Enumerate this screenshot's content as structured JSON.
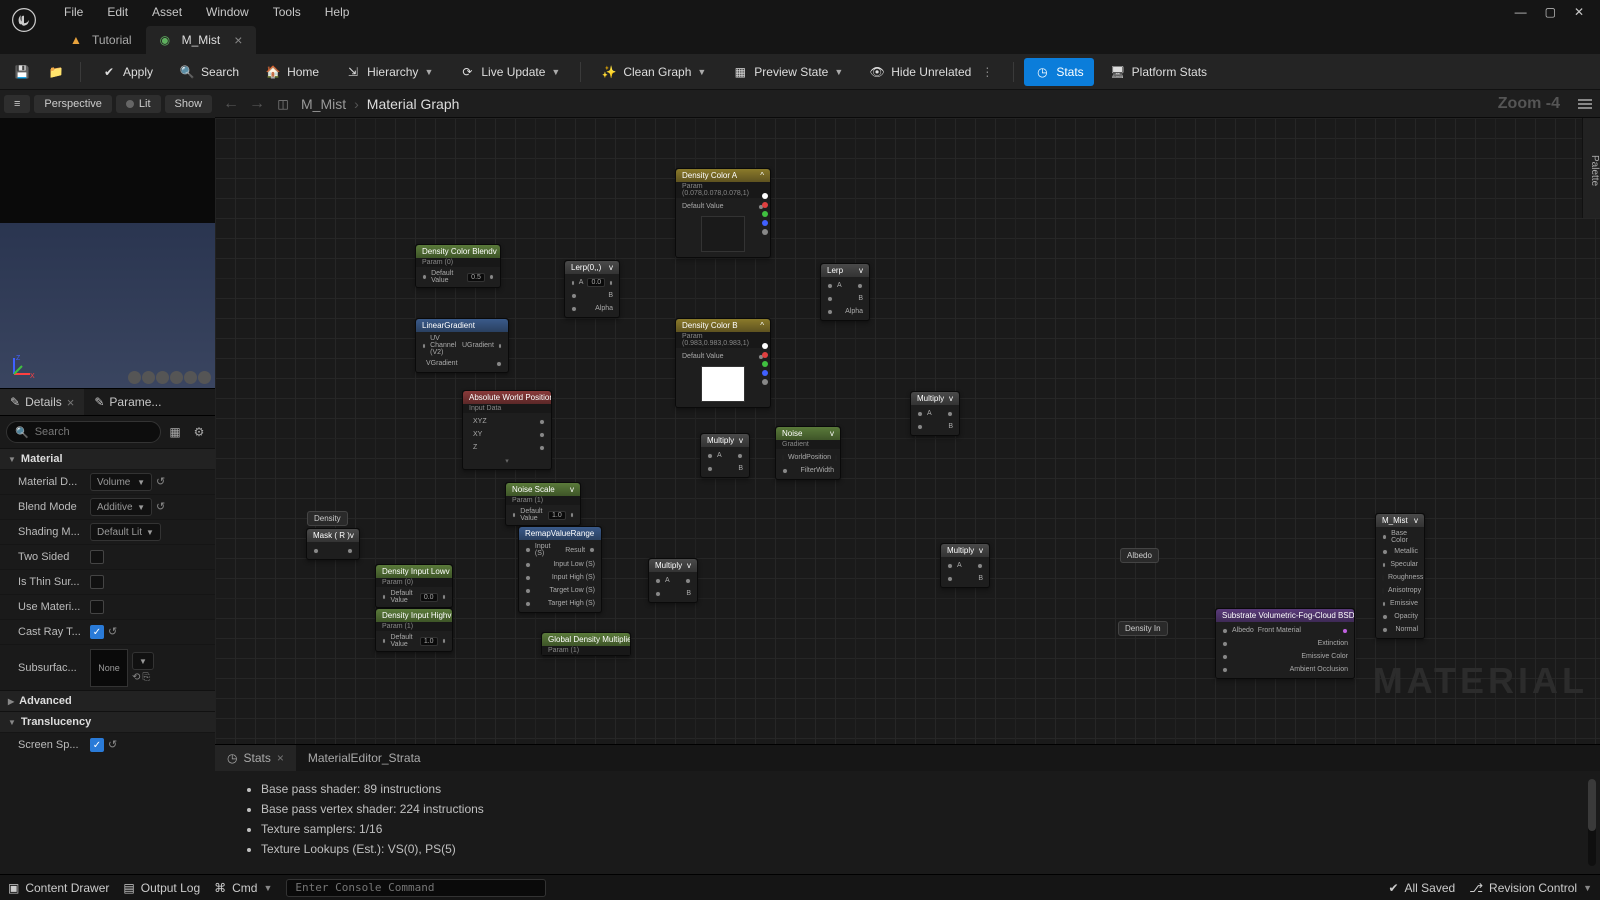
{
  "menu": {
    "items": [
      "File",
      "Edit",
      "Asset",
      "Window",
      "Tools",
      "Help"
    ]
  },
  "tabs": [
    {
      "label": "Tutorial",
      "active": false,
      "icon": "tutorial"
    },
    {
      "label": "M_Mist",
      "active": true,
      "icon": "material"
    }
  ],
  "toolbar": {
    "apply": "Apply",
    "search": "Search",
    "home": "Home",
    "hierarchy": "Hierarchy",
    "liveupdate": "Live Update",
    "cleangraph": "Clean Graph",
    "previewstate": "Preview State",
    "hideunrelated": "Hide Unrelated",
    "stats": "Stats",
    "platformstats": "Platform Stats"
  },
  "viewport": {
    "perspective": "Perspective",
    "lit": "Lit",
    "show": "Show",
    "menu": "≡"
  },
  "crumb": {
    "root": "M_Mist",
    "leaf": "Material Graph",
    "zoom": "Zoom -4"
  },
  "palette_label": "Palette",
  "panels": {
    "details": "Details",
    "params": "Parame..."
  },
  "search_placeholder": "Search",
  "categories": {
    "material": "Material",
    "advanced": "Advanced",
    "translucency": "Translucency"
  },
  "props": {
    "material_domain": {
      "label": "Material D...",
      "value": "Volume"
    },
    "blend_mode": {
      "label": "Blend Mode",
      "value": "Additive"
    },
    "shading_model": {
      "label": "Shading M...",
      "value": "Default Lit"
    },
    "two_sided": {
      "label": "Two Sided",
      "checked": false
    },
    "is_thin": {
      "label": "Is Thin Sur...",
      "checked": false
    },
    "use_materi": {
      "label": "Use Materi...",
      "checked": false
    },
    "cast_ray": {
      "label": "Cast Ray T...",
      "checked": true
    },
    "subsurface": {
      "label": "Subsurfac...",
      "value": "None"
    },
    "screen_sp": {
      "label": "Screen Sp...",
      "checked": true
    }
  },
  "nodes": {
    "density_color_a": {
      "title": "Density Color A",
      "sub": "Param (0.078,0.078,0.078,1)",
      "default": "Default Value"
    },
    "density_color_b": {
      "title": "Density Color B",
      "sub": "Param (0.983,0.983,0.983,1)",
      "default": "Default Value"
    },
    "density_color_blend": {
      "title": "Density Color Blend",
      "sub": "Param (0)",
      "default": "Default Value",
      "val": "0.5"
    },
    "linear_gradient": {
      "title": "LinearGradient",
      "uv": "UV Channel (V2)",
      "out1": "UGradient",
      "out2": "VGradient"
    },
    "lerp1": {
      "title": "Lerp(0,,)",
      "a": "A",
      "aval": "0.0",
      "b": "B",
      "alpha": "Alpha"
    },
    "lerp2": {
      "title": "Lerp",
      "a": "A",
      "b": "B",
      "alpha": "Alpha"
    },
    "awp": {
      "title": "Absolute World Position",
      "sub": "Input Data",
      "xyz": "XYZ",
      "xy": "XY",
      "z": "Z"
    },
    "noise_scale": {
      "title": "Noise Scale",
      "sub": "Param (1)",
      "default": "Default Value",
      "val": "1.0"
    },
    "mult1": {
      "title": "Multiply",
      "a": "A",
      "b": "B"
    },
    "mult2": {
      "title": "Multiply",
      "a": "A",
      "b": "B"
    },
    "mult3": {
      "title": "Multiply",
      "a": "A",
      "b": "B"
    },
    "mult4": {
      "title": "Multiply",
      "a": "A",
      "b": "B"
    },
    "noise": {
      "title": "Noise",
      "sub": "Gradient",
      "p": "WorldPosition",
      "fw": "FilterWidth"
    },
    "density": {
      "title": "Density"
    },
    "mask": {
      "title": "Mask ( R )"
    },
    "remap": {
      "title": "RemapValueRange",
      "in": "Input (S)",
      "il": "Input Low (S)",
      "ih": "Input High (S)",
      "tl": "Target Low (S)",
      "th": "Target High (S)",
      "res": "Result"
    },
    "dil": {
      "title": "Density Input Low",
      "sub": "Param (0)",
      "default": "Default Value",
      "val": "0.0"
    },
    "dih": {
      "title": "Density Input High",
      "sub": "Param (1)",
      "default": "Default Value",
      "val": "1.0"
    },
    "gdm": {
      "title": "Global Density Multiplier",
      "sub": "Param (1)"
    },
    "albedo": {
      "title": "Albedo"
    },
    "densityin": {
      "title": "Density In"
    },
    "svfc": {
      "title": "Substrate Volumetric-Fog-Cloud BSDF",
      "albedo": "Albedo",
      "ext": "Extinction",
      "emis": "Emissive Color",
      "amb": "Ambient Occlusion",
      "front": "Front Material"
    },
    "output": {
      "title": "M_Mist"
    }
  },
  "bottompanel": {
    "stats_tab": "Stats",
    "strata_tab": "MaterialEditor_Strata",
    "lines": [
      "Base pass shader: 89 instructions",
      "Base pass vertex shader: 224 instructions",
      "Texture samplers: 1/16",
      "Texture Lookups (Est.): VS(0), PS(5)"
    ]
  },
  "statusbar": {
    "content_drawer": "Content Drawer",
    "output_log": "Output Log",
    "cmd": "Cmd",
    "cmd_placeholder": "Enter Console Command",
    "allsaved": "All Saved",
    "revision": "Revision Control"
  }
}
